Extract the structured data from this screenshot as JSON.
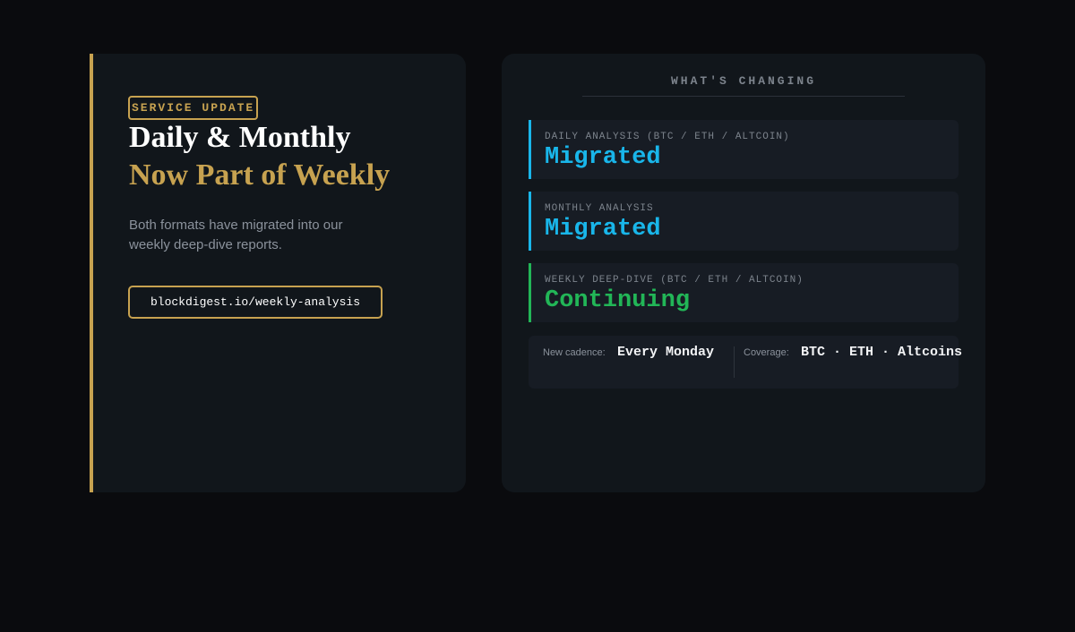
{
  "left_panel": {
    "badge": "SERVICE UPDATE",
    "title_line1": "Daily & Monthly",
    "title_line2": "Now Part of Weekly",
    "description": "Both formats have migrated into our weekly deep-dive reports.",
    "url_button": "blockdigest.io/weekly-analysis"
  },
  "right_panel": {
    "title": "WHAT'S CHANGING",
    "items": [
      {
        "label": "DAILY ANALYSIS (BTC / ETH / ALTCOIN)",
        "status": "Migrated",
        "color": "#19b6ea"
      },
      {
        "label": "MONTHLY ANALYSIS",
        "status": "Migrated",
        "color": "#19b6ea"
      },
      {
        "label": "WEEKLY DEEP-DIVE (BTC / ETH / ALTCOIN)",
        "status": "Continuing",
        "color": "#22b657"
      }
    ],
    "info": {
      "cadence_label": "New cadence:",
      "cadence_value": "Every Monday",
      "coverage_label": "Coverage:",
      "coverage_value": "BTC · ETH · Altcoins"
    }
  },
  "colors": {
    "background": "#0a0b0e",
    "panel": "#11161b",
    "gold": "#c7a250",
    "blue": "#19b6ea",
    "green": "#22b657"
  }
}
